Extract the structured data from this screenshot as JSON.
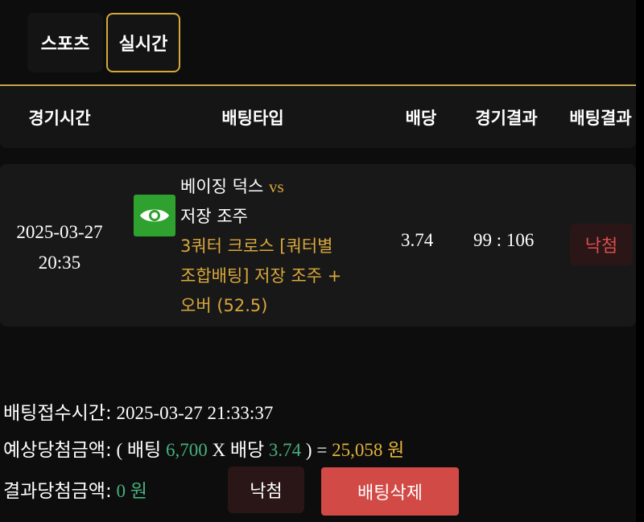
{
  "tabs": [
    {
      "label": "스포츠"
    },
    {
      "label": "실시간"
    }
  ],
  "table": {
    "headers": [
      "경기시간",
      "배팅타입",
      "배당",
      "경기결과",
      "배팅결과"
    ],
    "row": {
      "date": "2025-03-27",
      "time": "20:35",
      "home_team": "베이징 덕스",
      "vs": "vs",
      "away_team": "저장 조주",
      "bet_line1": "3쿼터 크로스 [쿼터별",
      "bet_line2": "조합배팅] 저장 조주 +",
      "bet_line3": "오버 (52.5)",
      "odds": "3.74",
      "score": "99 : 106",
      "result": "낙첨"
    }
  },
  "summary": {
    "received_label": "배팅접수시간:",
    "received_value": "2025-03-27 21:33:37",
    "expected_label": "예상당첨금액:",
    "open_paren": "(",
    "bet_word": "배팅",
    "bet_amount": "6,700",
    "times": "X",
    "odds_word": "배당",
    "odds_value": "3.74",
    "close_eq": ") =",
    "expected_amount": "25,058",
    "won_unit": "원",
    "result_label": "결과당첨금액:",
    "result_amount": "0",
    "result_unit": "원",
    "status_button": "낙첨",
    "delete_button": "배팅삭제"
  },
  "colors": {
    "accent_gold": "#d9a73c",
    "green": "#47b07e",
    "loss_red": "#dc4c4c",
    "delete_red": "#d24a45",
    "eye_green": "#2ea12e"
  },
  "icons": {
    "eye": "eye-icon"
  }
}
